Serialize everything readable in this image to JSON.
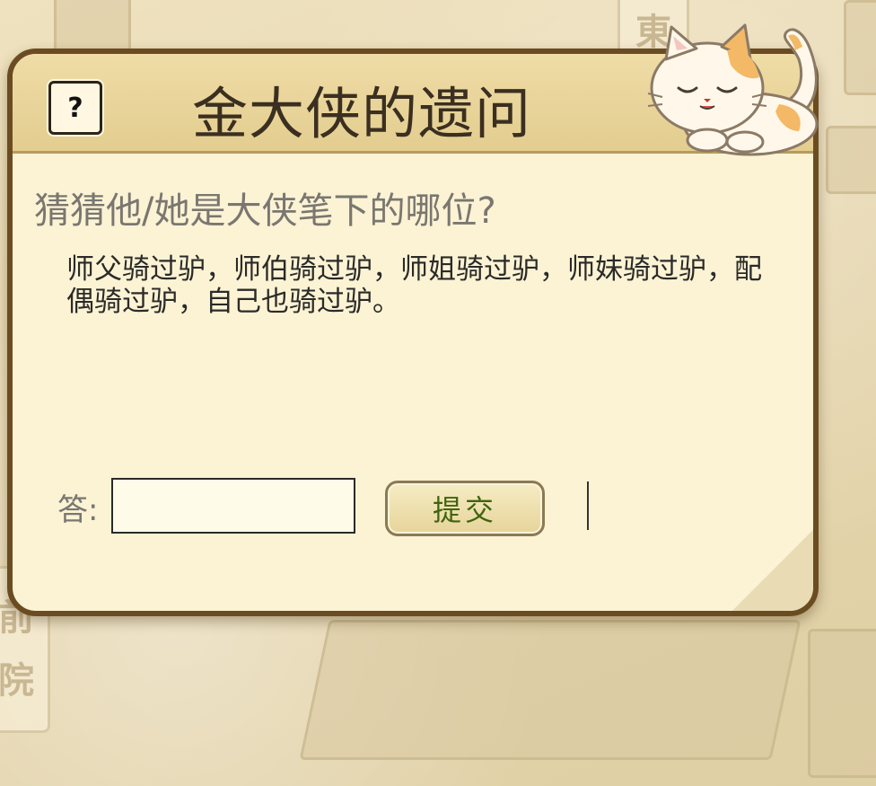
{
  "background": {
    "plaque_top": "東",
    "plaque_left": "前\n院"
  },
  "dialog": {
    "help_icon": "?",
    "title": "金大侠的遗问",
    "question": "猜猜他/她是大侠笔下的哪位?",
    "clue": "师父骑过驴，师伯骑过驴，师姐骑过驴，师妹骑过驴，配偶骑过驴，自己也骑过驴。",
    "answer_label": "答:",
    "answer_value": "",
    "answer_placeholder": "",
    "submit_label": "提交"
  },
  "icons": {
    "help": "question-mark-icon",
    "mascot": "sleeping-cat-icon"
  },
  "colors": {
    "frame": "#6b4c22",
    "panel": "#fbf3d4",
    "header": "#e3cd8f",
    "submit_text": "#3f6410"
  }
}
